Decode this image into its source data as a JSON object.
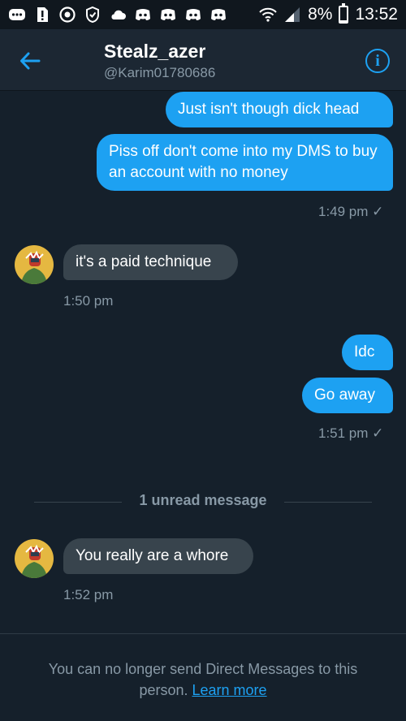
{
  "status_bar": {
    "battery": "8%",
    "time": "13:52",
    "battery_level": 0.08
  },
  "header": {
    "title": "Stealz_azer",
    "handle": "@Karim01780686"
  },
  "messages": [
    {
      "text": "Just isn't though dick head"
    },
    {
      "text": "Piss off don't come into my DMS to buy an account with no money"
    },
    {
      "time": "1:49 pm ✓"
    },
    {
      "text": "it's a paid technique"
    },
    {
      "time": "1:50 pm"
    },
    {
      "text": "Idc"
    },
    {
      "text": "Go away"
    },
    {
      "time": "1:51 pm ✓"
    },
    {
      "divider": "1 unread message"
    },
    {
      "text": "You really are a whore"
    },
    {
      "time": "1:52 pm"
    }
  ],
  "footer": {
    "text": "You can no longer send Direct Messages to this person.",
    "link": "Learn more"
  },
  "colors": {
    "background": "#15202b",
    "header": "#1c2733",
    "sent_bubble": "#1da1f2",
    "received_bubble": "#38444d",
    "muted_text": "#8899a6"
  },
  "icons": [
    "notification-icon",
    "sim-alert-icon",
    "sync-icon",
    "shield-icon",
    "cloud-icon",
    "discord-icon",
    "wifi-icon",
    "signal-icon",
    "battery-icon",
    "back-arrow-icon",
    "info-icon",
    "avatar"
  ]
}
